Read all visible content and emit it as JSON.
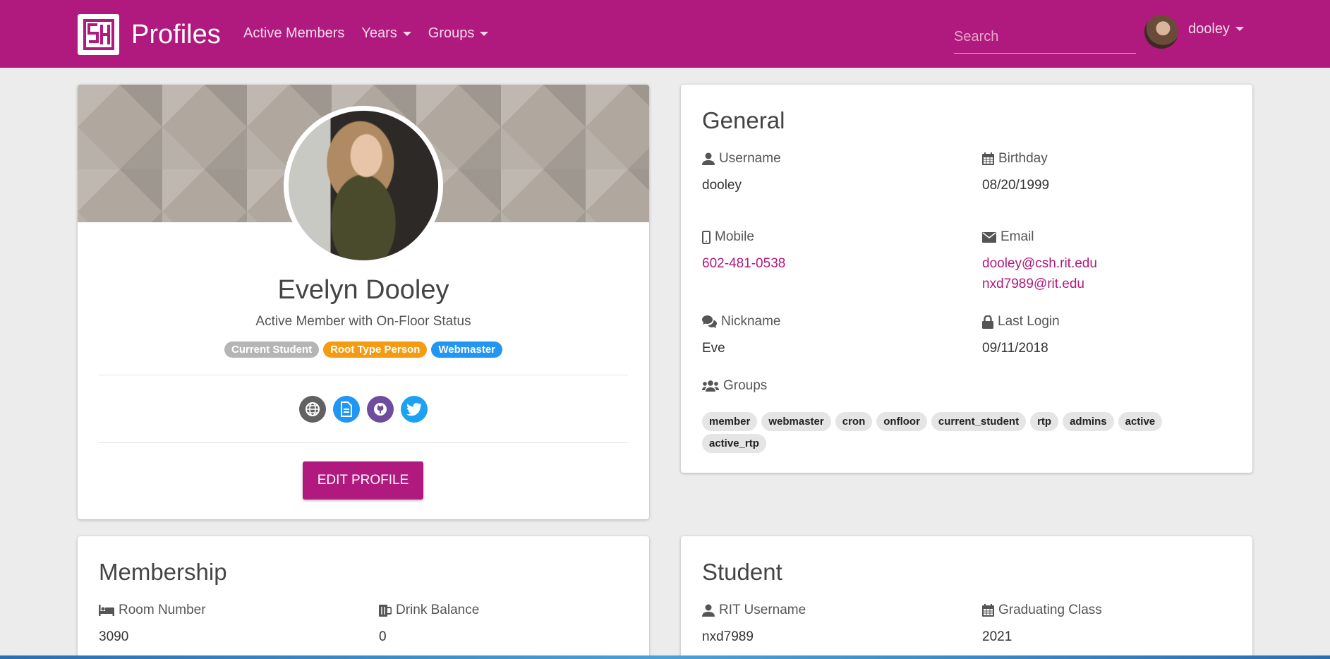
{
  "navbar": {
    "brand": "Profiles",
    "links": [
      {
        "label": "Active Members",
        "dropdown": false
      },
      {
        "label": "Years",
        "dropdown": true
      },
      {
        "label": "Groups",
        "dropdown": true
      }
    ],
    "search_placeholder": "Search",
    "user": "dooley",
    "color": "#b0197e"
  },
  "profile": {
    "name": "Evelyn Dooley",
    "subtitle": "Active Member with On-Floor Status",
    "badges": [
      {
        "label": "Current Student",
        "color": "#b5b5b5"
      },
      {
        "label": "Root Type Person",
        "color": "#f39c12"
      },
      {
        "label": "Webmaster",
        "color": "#2196f3"
      }
    ],
    "socials": [
      {
        "icon": "globe-icon",
        "color": "#616161"
      },
      {
        "icon": "document-icon",
        "color": "#2196f3"
      },
      {
        "icon": "github-icon",
        "color": "#6e4c9e"
      },
      {
        "icon": "twitter-icon",
        "color": "#1da1f2"
      }
    ],
    "edit_label": "EDIT PROFILE"
  },
  "general": {
    "title": "General",
    "username_label": "Username",
    "username": "dooley",
    "birthday_label": "Birthday",
    "birthday": "08/20/1999",
    "mobile_label": "Mobile",
    "mobile": "602-481-0538",
    "email_label": "Email",
    "emails": [
      "dooley@csh.rit.edu",
      "nxd7989@rit.edu"
    ],
    "nickname_label": "Nickname",
    "nickname": "Eve",
    "last_login_label": "Last Login",
    "last_login": "09/11/2018",
    "groups_label": "Groups",
    "groups": [
      "member",
      "webmaster",
      "cron",
      "onfloor",
      "current_student",
      "rtp",
      "admins",
      "active",
      "active_rtp"
    ]
  },
  "membership": {
    "title": "Membership",
    "room_label": "Room Number",
    "room": "3090",
    "drink_label": "Drink Balance",
    "drink": "0"
  },
  "student": {
    "title": "Student",
    "rit_username_label": "RIT Username",
    "rit_username": "nxd7989",
    "grad_label": "Graduating Class",
    "grad": "2021"
  }
}
